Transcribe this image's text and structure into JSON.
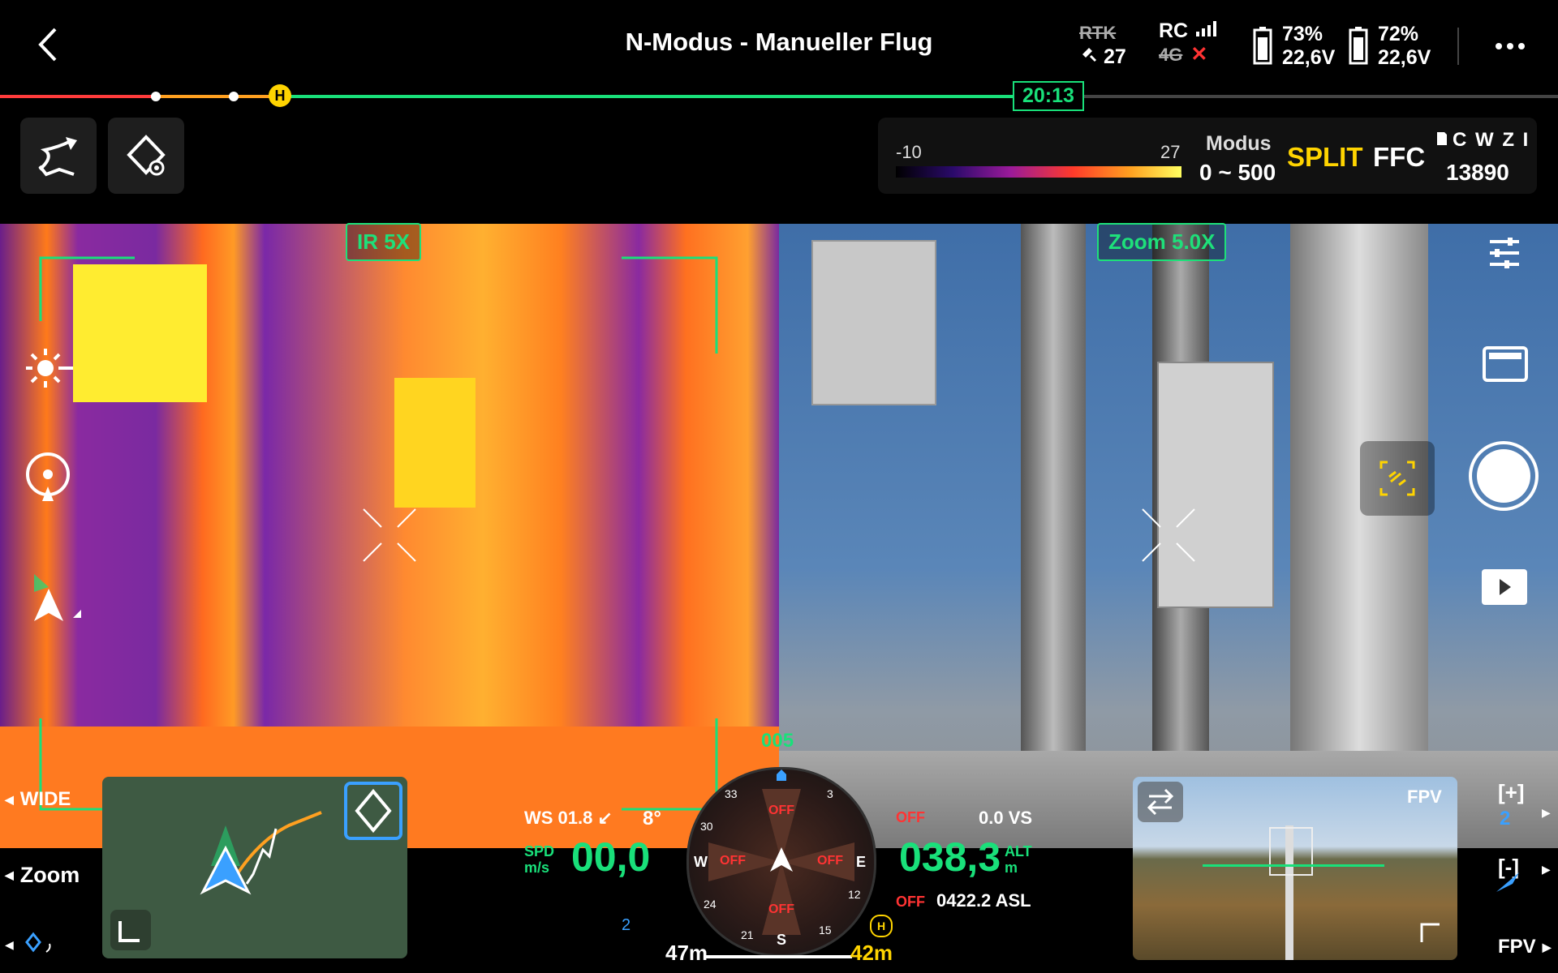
{
  "header": {
    "title": "N-Modus - Manueller Flug",
    "rtk_label": "RTK",
    "satellites": "27",
    "rc_label": "RC",
    "net_label": "4G",
    "battery1": {
      "percent": "73%",
      "voltage": "22,6V"
    },
    "battery2": {
      "percent": "72%",
      "voltage": "22,6V"
    }
  },
  "timeline": {
    "time": "20:13",
    "home_marker": "H"
  },
  "thermal": {
    "scale_min": "-10",
    "scale_max": "27",
    "modus_label": "Modus",
    "modus_range": "0 ~ 500",
    "split": "SPLIT",
    "ffc": "FFC",
    "storage_label": "C W Z I",
    "storage_count": "13890"
  },
  "views": {
    "ir_label": "IR  5X",
    "zoom_label": "Zoom  5.0X"
  },
  "left_controls": {
    "wide": "WIDE",
    "zoom": "Zoom"
  },
  "telemetry": {
    "heading": "005",
    "ws": "WS 01.8",
    "ws_arrow": "↙",
    "angle": "8°",
    "spd_label": "SPD",
    "spd_unit": "m/s",
    "speed": "00,0",
    "alt_off": "OFF",
    "vs": "0.0 VS",
    "altitude": "038,3",
    "alt_label": "ALT",
    "alt_unit": "m",
    "asl_off": "OFF",
    "asl": "0422.2 ASL",
    "dist_left": "47m",
    "dist_right": "42m",
    "nav_count": "2",
    "compass": {
      "N_off": "OFF",
      "W_off": "OFF",
      "E_off": "OFF",
      "S_off": "OFF",
      "W": "W",
      "E": "E",
      "S": "S",
      "t33": "33",
      "t3": "3",
      "t30": "30",
      "t12": "12",
      "t24": "24",
      "t21": "21",
      "t15": "15"
    }
  },
  "right_controls": {
    "fpv_label": "FPV",
    "fpv_mini_label": "FPV",
    "zoom_in": "[+]",
    "zoom_out": "[-]",
    "count": "2"
  },
  "colors": {
    "accent": "#19e07a",
    "warning": "#ffd400",
    "danger": "#ff3333"
  }
}
